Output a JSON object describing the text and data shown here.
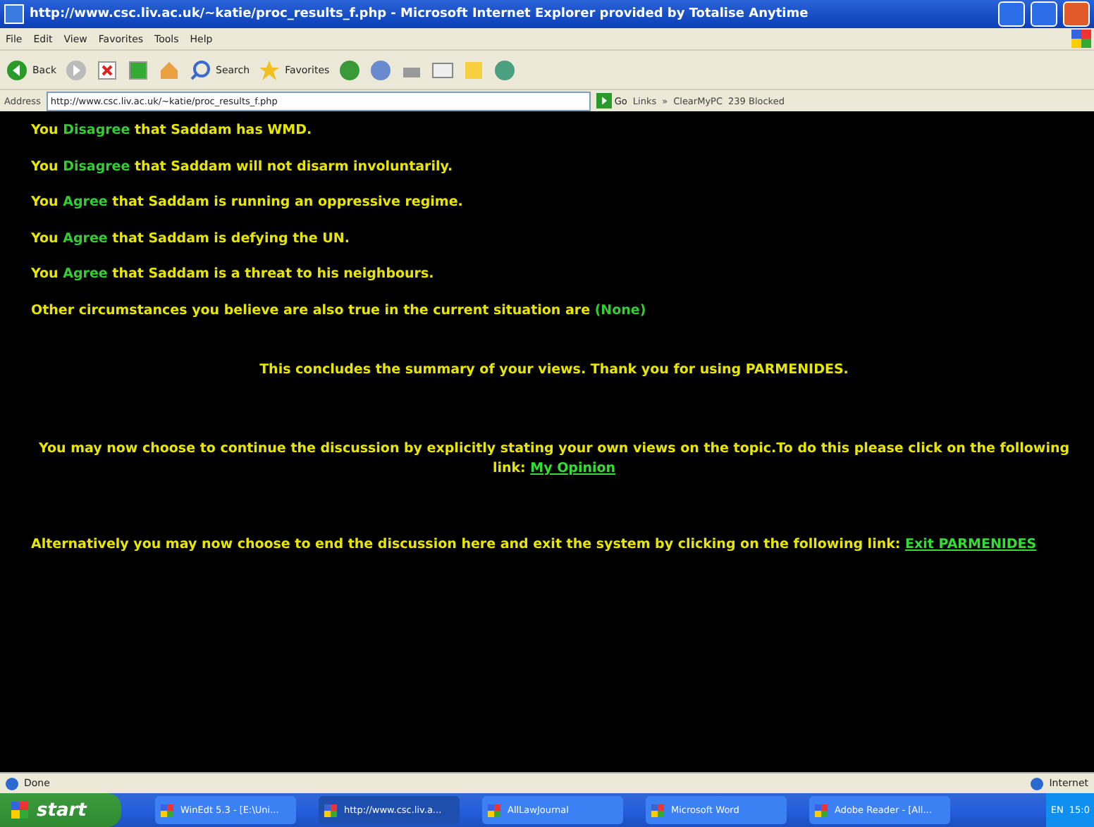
{
  "window": {
    "title": "http://www.csc.liv.ac.uk/~katie/proc_results_f.php - Microsoft Internet Explorer provided by Totalise Anytime"
  },
  "menu": [
    "File",
    "Edit",
    "View",
    "Favorites",
    "Tools",
    "Help"
  ],
  "toolbar": {
    "back": "Back",
    "search": "Search",
    "favorites": "Favorites"
  },
  "address_bar": {
    "label": "Address",
    "value": "http://www.csc.liv.ac.uk/~katie/proc_results_f.php",
    "go": "Go",
    "links": "Links",
    "chevron": "»",
    "clean": "ClearMyPC",
    "blocked": "239 Blocked"
  },
  "statements": [
    {
      "parts": [
        {
          "text": "You ",
          "kind": "plain"
        },
        {
          "text": "Disagree",
          "kind": "highlight"
        },
        {
          "text": " that Saddam has WMD.",
          "kind": "plain"
        }
      ]
    },
    {
      "parts": [
        {
          "text": "You ",
          "kind": "plain"
        },
        {
          "text": "Disagree",
          "kind": "highlight"
        },
        {
          "text": " that Saddam will not disarm involuntarily.",
          "kind": "plain"
        }
      ]
    },
    {
      "parts": [
        {
          "text": "You ",
          "kind": "plain"
        },
        {
          "text": "Agree",
          "kind": "highlight"
        },
        {
          "text": " that Saddam is running an oppressive regime.",
          "kind": "plain"
        }
      ]
    },
    {
      "parts": [
        {
          "text": "You ",
          "kind": "plain"
        },
        {
          "text": "Agree",
          "kind": "highlight"
        },
        {
          "text": " that Saddam is defying the UN.",
          "kind": "plain"
        }
      ]
    },
    {
      "parts": [
        {
          "text": "You ",
          "kind": "plain"
        },
        {
          "text": "Agree",
          "kind": "highlight"
        },
        {
          "text": " that Saddam is a threat to his neighbours.",
          "kind": "plain"
        }
      ]
    },
    {
      "parts": [
        {
          "text": "Other circumstances you believe are also true in the current situation are ",
          "kind": "plain"
        },
        {
          "text": "(None)",
          "kind": "highlight"
        }
      ]
    }
  ],
  "conclusion": "This concludes the summary of your views. Thank you for using PARMENIDES.",
  "continue": {
    "text": "You may now choose to continue the discussion by explicitly stating your own views on the topic.To do this please click on the following link: ",
    "link": "My Opinion"
  },
  "exit": {
    "text": "Alternatively you may now choose to end the discussion here and exit the system by clicking on the following link: ",
    "link": "Exit PARMENIDES"
  },
  "status_bar": {
    "text": "Done",
    "zone": "Internet"
  },
  "taskbar": {
    "start": "start",
    "items": [
      {
        "label": "WinEdt 5.3 - [E:\\Uni...",
        "selected": false
      },
      {
        "label": "http://www.csc.liv.a...",
        "selected": true
      },
      {
        "label": "AllLawJournal",
        "selected": false
      },
      {
        "label": "Microsoft Word",
        "selected": false
      },
      {
        "label": "Adobe Reader - [All...",
        "selected": false
      }
    ],
    "lang": "EN",
    "clock": "15:0"
  }
}
